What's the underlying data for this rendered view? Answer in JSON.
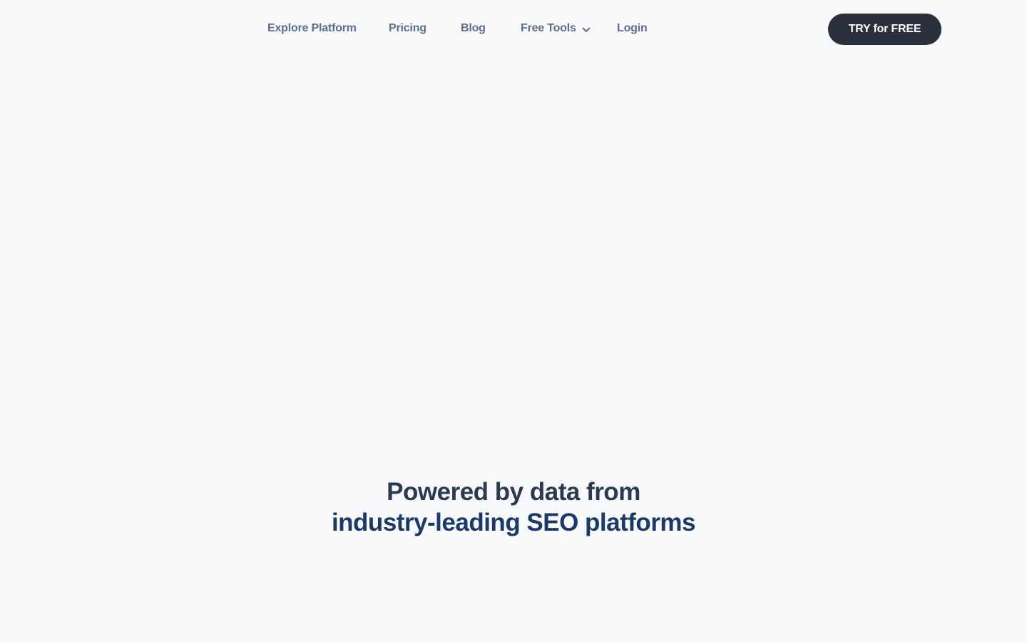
{
  "nav": {
    "items": [
      {
        "label": "Explore Platform"
      },
      {
        "label": "Pricing"
      },
      {
        "label": "Blog"
      },
      {
        "label": "Free Tools",
        "icon": "chevron-down-icon"
      },
      {
        "label": "Login"
      }
    ],
    "cta_label": "TRY for FREE"
  },
  "hero": {
    "line1": "Powered by data from",
    "line2": "industry-leading SEO platforms"
  },
  "colors": {
    "background": "#f7f8f9",
    "nav_text": "#5d6f86",
    "cta_background": "#2a303c",
    "cta_text": "#ffffff",
    "heading_dark": "#2c3950",
    "heading_blue": "#1d3a66"
  }
}
